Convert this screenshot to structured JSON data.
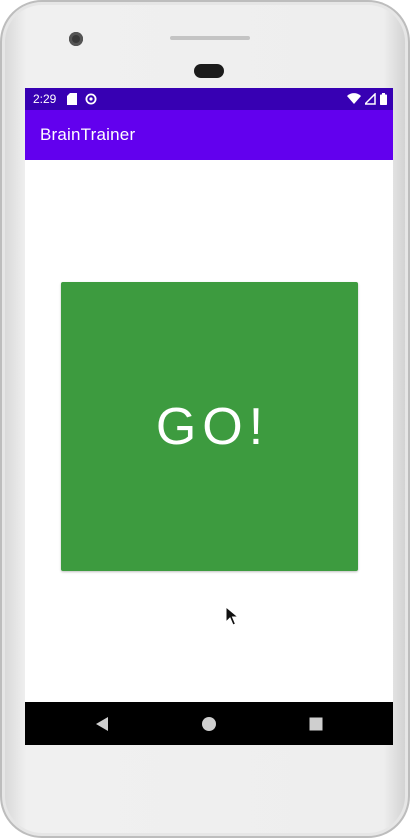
{
  "status_bar": {
    "time": "2:29",
    "left_icons": [
      "sd-card-icon",
      "data-saver-icon"
    ],
    "right_icons": [
      "wifi-icon",
      "signal-icon",
      "battery-icon"
    ],
    "color": "#3700b3"
  },
  "app_bar": {
    "title": "BrainTrainer",
    "color": "#6200ee"
  },
  "main": {
    "go_label": "GO!",
    "go_color": "#3d9b3f"
  },
  "nav_bar": {
    "buttons": [
      "back-icon",
      "home-icon",
      "recents-icon"
    ]
  }
}
